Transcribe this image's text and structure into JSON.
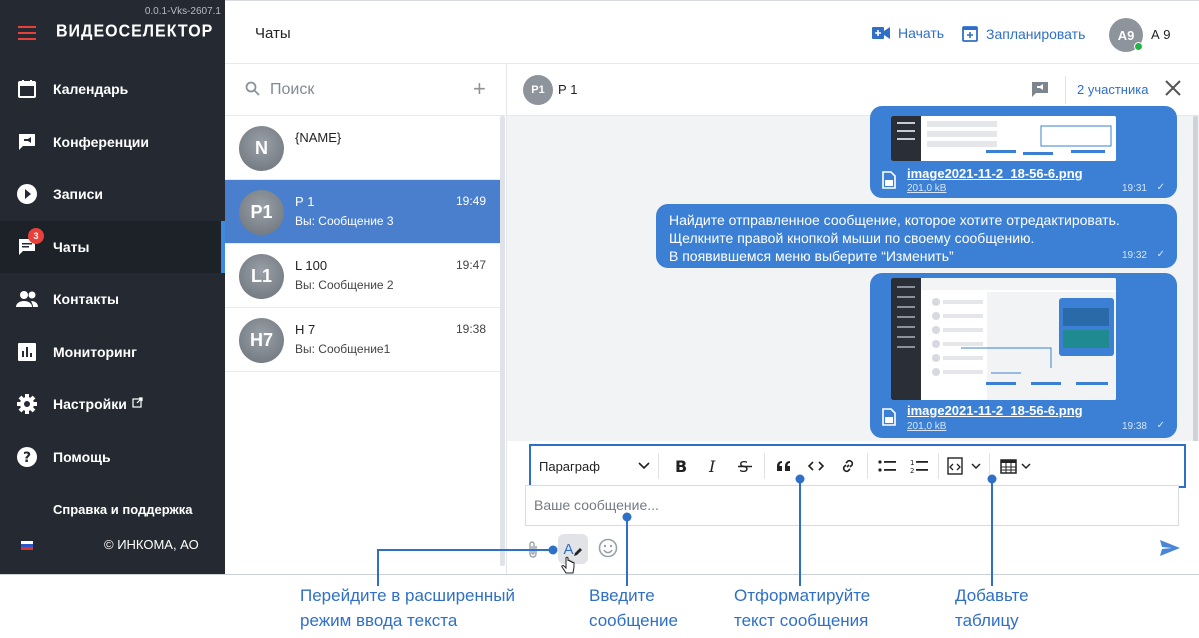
{
  "app": {
    "version": "0.0.1-Vks-2607.1",
    "logo": "ВИДЕОСЕЛЕКТОР",
    "page_title": "Чаты"
  },
  "sidebar": {
    "items": [
      {
        "label": "Календарь",
        "icon": "calendar-icon"
      },
      {
        "label": "Конференции",
        "icon": "conference-icon"
      },
      {
        "label": "Записи",
        "icon": "play-icon"
      },
      {
        "label": "Чаты",
        "icon": "chat-icon",
        "badge": "3",
        "active": true
      },
      {
        "label": "Контакты",
        "icon": "contacts-icon"
      },
      {
        "label": "Мониторинг",
        "icon": "chart-icon"
      },
      {
        "label": "Настройки",
        "icon": "gear-icon",
        "external": true
      },
      {
        "label": "Помощь",
        "icon": "help-icon"
      }
    ],
    "support": "Справка и поддержка",
    "copyright": "© ИНКОМА, АО"
  },
  "topbar": {
    "start": "Начать",
    "schedule": "Запланировать",
    "avatar": "А9",
    "user": "А 9"
  },
  "chatlist": {
    "search_placeholder": "Поиск",
    "chats": [
      {
        "avatar": "N",
        "name": "{NAME}",
        "time": "",
        "last": ""
      },
      {
        "avatar": "P1",
        "name": "Р 1",
        "time": "19:49",
        "last": "Вы: Сообщение 3",
        "active": true
      },
      {
        "avatar": "L1",
        "name": "L 100",
        "time": "19:47",
        "last": "Вы: Сообщение 2"
      },
      {
        "avatar": "H7",
        "name": "H 7",
        "time": "19:38",
        "last": "Вы: Сообщение1"
      }
    ]
  },
  "chat": {
    "avatar": "Р1",
    "name": "Р 1",
    "members": "2 участника",
    "messages": [
      {
        "file": "image2021-11-2_18-56-6.png",
        "size": "201,0 kB",
        "time": "19:31"
      },
      {
        "lines": [
          "Найдите отправленное сообщение, которое хотите отредактировать.",
          "Щелкните правой кнопкой мыши по своему сообщению.",
          "В появившемся меню выберите “Изменить”"
        ],
        "time": "19:32"
      },
      {
        "file": "image2021-11-2_18-56-6.png",
        "size": "201,0 kB",
        "time": "19:38"
      }
    ]
  },
  "composer": {
    "paragraph": "Параграф",
    "placeholder": "Ваше сообщение...",
    "editor_button": "A"
  },
  "annotations": {
    "extended_mode": [
      "Перейдите в расширенный",
      "режим ввода текста"
    ],
    "enter_message": [
      "Введите",
      "сообщение"
    ],
    "format_text": [
      "Отформатируйте",
      "текст сообщения"
    ],
    "add_table": [
      "Добавьте",
      "таблицу"
    ]
  },
  "colors": {
    "sidebar_bg": "#252a32",
    "accent": "#2f6fc7",
    "active_chat": "#4a7fcd",
    "bubble": "#3b80d4",
    "badge": "#e8413c"
  }
}
